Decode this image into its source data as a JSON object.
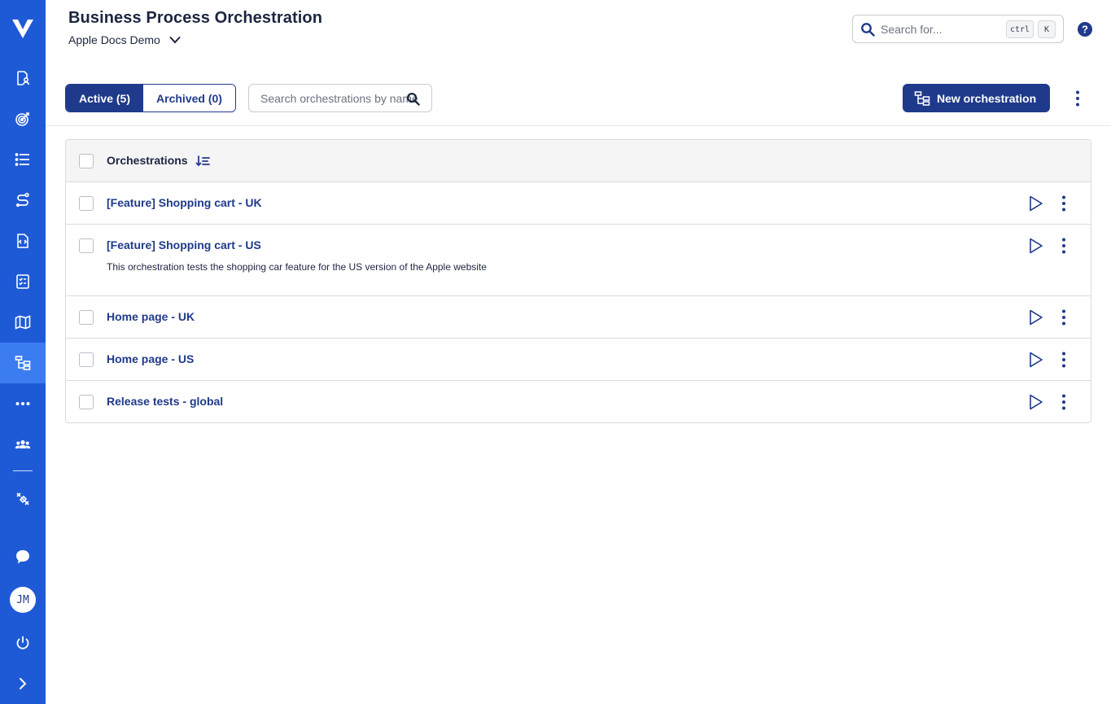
{
  "header": {
    "title": "Business Process Orchestration",
    "project": "Apple Docs Demo"
  },
  "global_search": {
    "placeholder": "Search for...",
    "shortcut_ctrl": "ctrl",
    "shortcut_key": "K"
  },
  "sidebar": {
    "items": [
      {
        "icon": "requirements-icon"
      },
      {
        "icon": "target-icon"
      },
      {
        "icon": "list-icon"
      },
      {
        "icon": "route-icon"
      },
      {
        "icon": "code-file-icon"
      },
      {
        "icon": "checklist-icon"
      },
      {
        "icon": "map-icon"
      },
      {
        "icon": "orchestration-icon",
        "active": true
      },
      {
        "icon": "more-icon"
      },
      {
        "icon": "team-icon"
      },
      {
        "icon": "satellite-icon"
      },
      {
        "icon": "chat-icon"
      },
      {
        "icon": "power-icon"
      },
      {
        "icon": "expand-icon"
      }
    ],
    "avatar_initials": "JM"
  },
  "toolbar": {
    "tab_active": "Active (5)",
    "tab_archived": "Archived (0)",
    "search_placeholder": "Search orchestrations by name",
    "new_button": "New orchestration"
  },
  "table": {
    "header": "Orchestrations",
    "rows": [
      {
        "name": "[Feature] Shopping cart - UK",
        "description": ""
      },
      {
        "name": "[Feature] Shopping cart - US",
        "description": "This orchestration tests the shopping car feature for the US version of the Apple website"
      },
      {
        "name": "Home page - UK",
        "description": ""
      },
      {
        "name": "Home page - US",
        "description": ""
      },
      {
        "name": "Release tests - global",
        "description": ""
      }
    ]
  },
  "colors": {
    "sidebar": "#1f5ad6",
    "sidebar_active": "#3b7cf0",
    "primary": "#1f3a8a",
    "border": "#d9dce2"
  }
}
